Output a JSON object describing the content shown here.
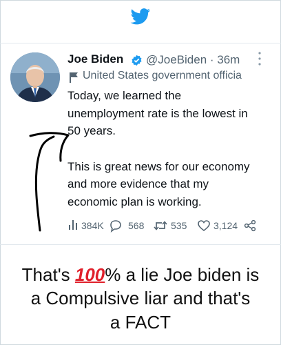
{
  "tweet": {
    "author_name": "Joe Biden",
    "handle_time": "@JoeBiden · 36m",
    "label": "United States government officia",
    "lines": [
      "Today, we learned the",
      "unemployment rate is the lowest in",
      "50 years.",
      "This is great news for our economy",
      "and more evidence that my",
      "economic plan is working."
    ],
    "stats": {
      "views": "384K",
      "replies": "568",
      "retweets": "535",
      "likes": "3,124"
    }
  },
  "caption": {
    "line1_before": "That's ",
    "line1_emoji": "100",
    "line1_after": "% a lie ",
    "line1_name": "Joe biden is",
    "line2": "a Compulsive liar and that's",
    "line3": "a FACT"
  },
  "colors": {
    "twitter_blue": "#1d9bf0",
    "verified_blue": "#1d9bf0",
    "secondary_text": "#536471",
    "emoji_red": "#e0202b"
  },
  "icons": [
    "twitter-bird-icon",
    "verified-badge-icon",
    "more-options-icon",
    "government-flag-icon",
    "views-icon",
    "reply-icon",
    "retweet-icon",
    "like-icon",
    "share-icon"
  ]
}
